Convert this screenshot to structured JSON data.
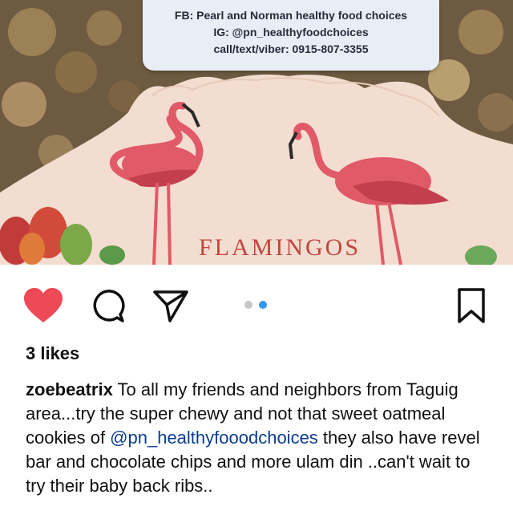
{
  "photo": {
    "sticker_lines": [
      "FB: Pearl and Norman healthy food choices",
      "IG: @pn_healthyfoodchoices",
      "call/text/viber: 0915-807-3355"
    ],
    "brand_text": "FLAMINGOS"
  },
  "actions": {
    "like_icon": "heart-filled-icon",
    "comment_icon": "comment-icon",
    "share_icon": "send-icon",
    "save_icon": "bookmark-icon",
    "carousel_count": 2,
    "carousel_active": 2,
    "like_color": "#ed4956",
    "dot_active_color": "#3897f0"
  },
  "post": {
    "likes": "3 likes",
    "username": "zoebeatrix",
    "caption_part1": " To all my friends and neighbors from Taguig area...try the super chewy and not that sweet oatmeal cookies of ",
    "mention": "@pn_healthyfooodchoices",
    "caption_part2": "  they also have revel bar and chocolate chips and more ulam din ..can't wait to try their baby back ribs.."
  }
}
